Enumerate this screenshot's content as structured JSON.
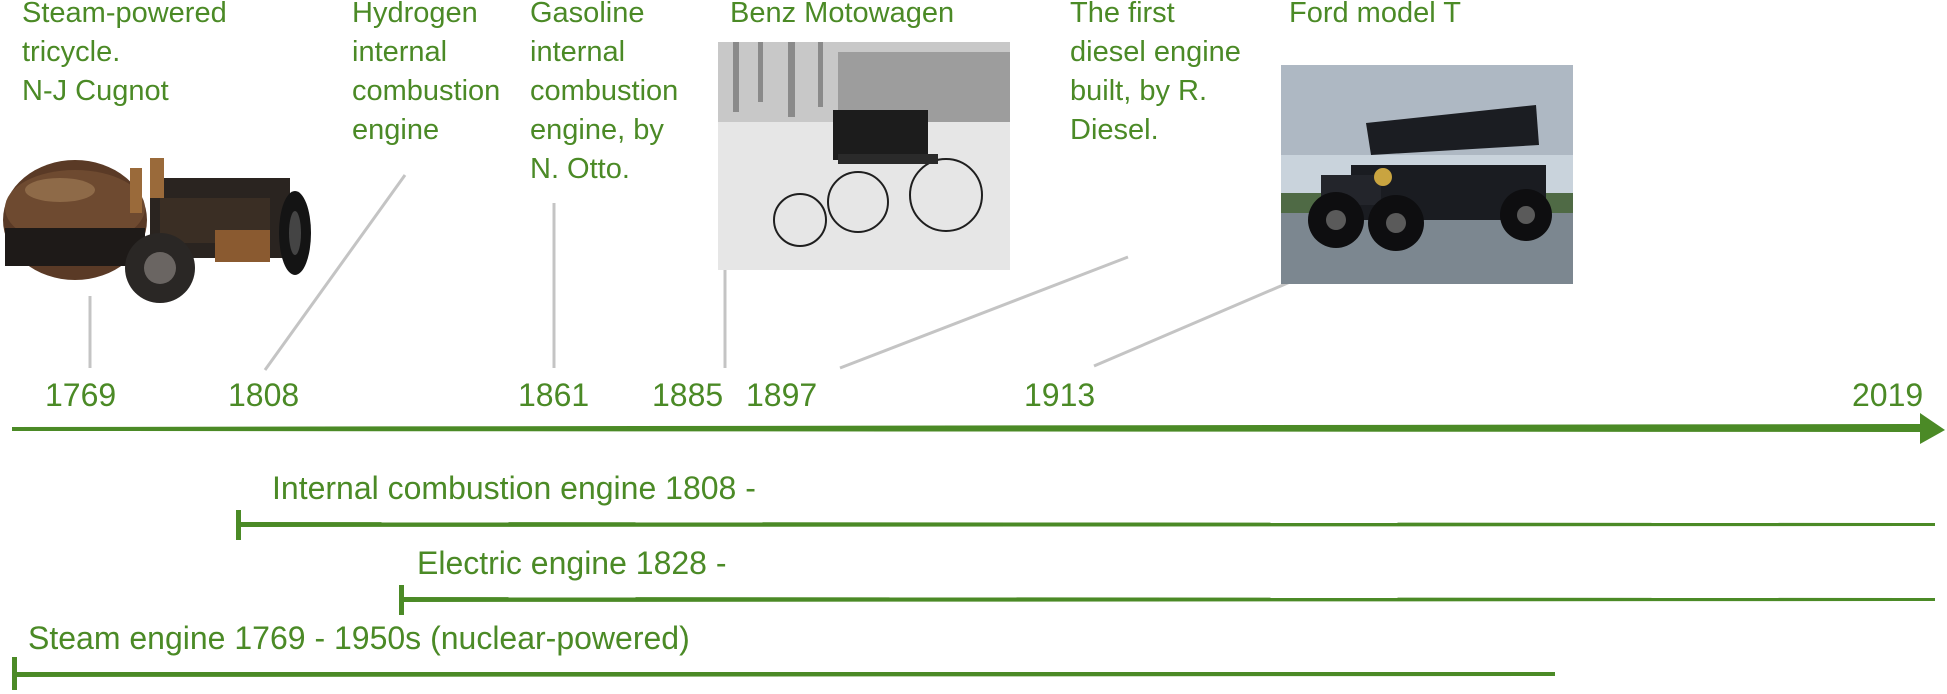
{
  "events": [
    {
      "lines": [
        "Steam-powered",
        "tricycle.",
        "N-J Cugnot"
      ],
      "year": "1769"
    },
    {
      "lines": [
        "Hydrogen",
        "internal",
        "combustion",
        "engine"
      ],
      "year": "1808"
    },
    {
      "lines": [
        "Gasoline",
        "internal",
        "combustion",
        "engine, by",
        "N. Otto."
      ],
      "year": "1861"
    },
    {
      "lines": [
        "Benz Motowagen"
      ],
      "year": "1885"
    },
    {
      "lines": [
        "The first",
        "diesel engine",
        "built, by R.",
        "Diesel."
      ],
      "year": "1897"
    },
    {
      "lines": [
        "Ford model T"
      ],
      "year": "1913"
    }
  ],
  "end_year": "2019",
  "ranges": [
    {
      "label": "Internal combustion engine 1808 -"
    },
    {
      "label": "Electric engine 1828 -"
    },
    {
      "label": "Steam engine 1769 - 1950s (nuclear-powered)"
    }
  ],
  "colors": {
    "accent": "#4b8a26",
    "connector": "#c4c4c4"
  },
  "images": [
    {
      "icon": "cugnot-steam-tricycle-photo"
    },
    {
      "icon": "benz-motorwagen-photo"
    },
    {
      "icon": "ford-model-t-photo"
    }
  ]
}
